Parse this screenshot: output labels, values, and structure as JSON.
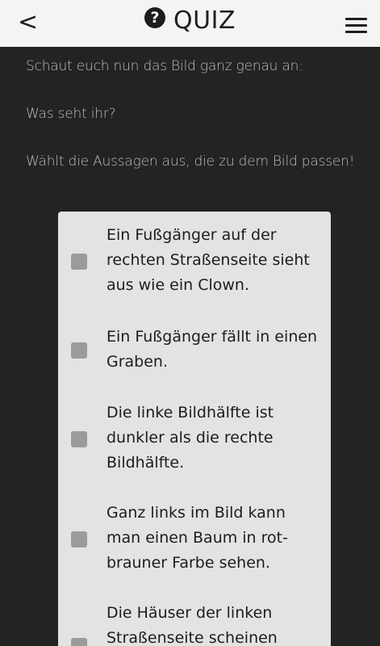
{
  "header": {
    "back_icon": "chevron-left-icon",
    "back_glyph": "<",
    "help_icon": "question-circle-icon",
    "help_glyph": "?",
    "title": "QUIZ",
    "menu_icon": "hamburger-menu-icon"
  },
  "content": {
    "line1": "Schaut euch nun das Bild ganz genau an:",
    "line2": "Was seht ihr?",
    "line3": "Wählt die Aussagen aus, die zu dem Bild passen!"
  },
  "options": [
    {
      "text": "Ein Fußgänger auf der rechten Straßenseite sieht aus wie ein Clown.",
      "checked": false
    },
    {
      "text": "Ein Fußgänger fällt in einen Graben.",
      "checked": false
    },
    {
      "text": "Die linke Bildhälfte ist dunkler als die rechte Bildhälfte.",
      "checked": false
    },
    {
      "text": "Ganz links im Bild kann man einen Baum in rot-brauner Farbe sehen.",
      "checked": false
    },
    {
      "text": "Die Häuser der linken Straßenseite scheinen",
      "checked": false
    }
  ],
  "colors": {
    "background": "#232323",
    "header": "#f4f4f4",
    "card": "#e3e3e3",
    "checkbox": "#9b9b9b"
  }
}
